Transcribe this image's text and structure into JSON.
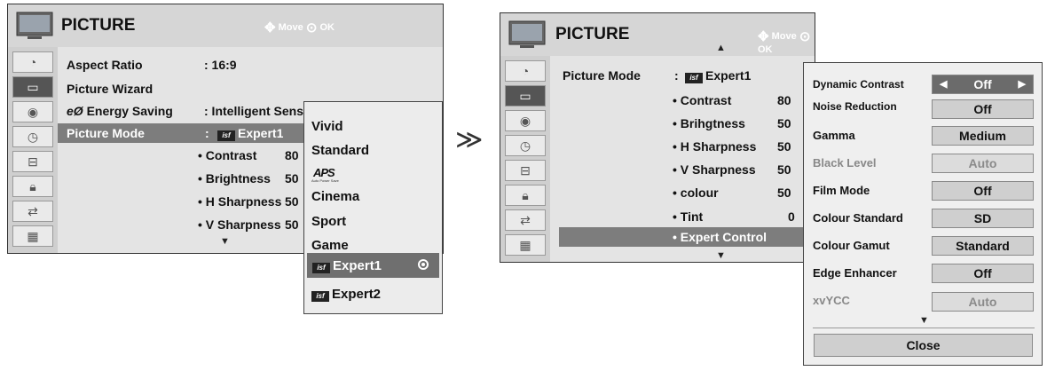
{
  "left_menu": {
    "title": "PICTURE",
    "hint_move": "Move",
    "hint_ok": "OK",
    "rows": {
      "aspect_label": "Aspect Ratio",
      "aspect_value": ": 16:9",
      "wizard_label": "Picture Wizard",
      "energy_label": "Energy Saving",
      "energy_value": ": Intelligent Senso",
      "mode_label": "Picture Mode",
      "mode_value": "Expert1",
      "mode_colon": ":",
      "contrast_label": "• Contrast",
      "contrast_value": "80",
      "brightness_label": "• Brightness",
      "brightness_value": "50",
      "hsharp_label": "• H Sharpness",
      "hsharp_value": "50",
      "vsharp_label": "• V Sharpness",
      "vsharp_value": "50"
    }
  },
  "mode_dropdown": {
    "items": [
      "Vivid",
      "Standard",
      "APS",
      "Cinema",
      "Sport",
      "Game"
    ],
    "aps_caption": "Auto Power Save",
    "selected": "Expert1",
    "expert2": "Expert2"
  },
  "right_menu": {
    "title": "PICTURE",
    "hint_move": "Move",
    "hint_ok": "OK",
    "mode_label": "Picture Mode",
    "mode_colon": ":",
    "mode_value": "Expert1",
    "rows": [
      {
        "label": "• Contrast",
        "value": "80"
      },
      {
        "label": "• Brihgtness",
        "value": "50"
      },
      {
        "label": "• H Sharpness",
        "value": "50"
      },
      {
        "label": "• V Sharpness",
        "value": "50"
      },
      {
        "label": "• colour",
        "value": "50"
      },
      {
        "label": "• Tint",
        "value": "0"
      }
    ],
    "expert_control": "• Expert Control"
  },
  "expert_panel": {
    "items": [
      {
        "label": "Dynamic Contrast",
        "value": "Off"
      },
      {
        "label": "Noise Reduction",
        "value": "Off"
      },
      {
        "label": "Gamma",
        "value": "Medium"
      },
      {
        "label": "Black Level",
        "value": "Auto"
      },
      {
        "label": "Film Mode",
        "value": "Off"
      },
      {
        "label": "Colour Standard",
        "value": "SD"
      },
      {
        "label": "Colour Gamut",
        "value": "Standard"
      },
      {
        "label": "Edge Enhancer",
        "value": "Off"
      },
      {
        "label": "xvYCC",
        "value": "Auto"
      }
    ],
    "close": "Close"
  },
  "badge_text": "isf",
  "colors": {
    "highlight": "#7d7d7d",
    "panel": "#e4e4e4",
    "selected": "#6b6b6b"
  }
}
